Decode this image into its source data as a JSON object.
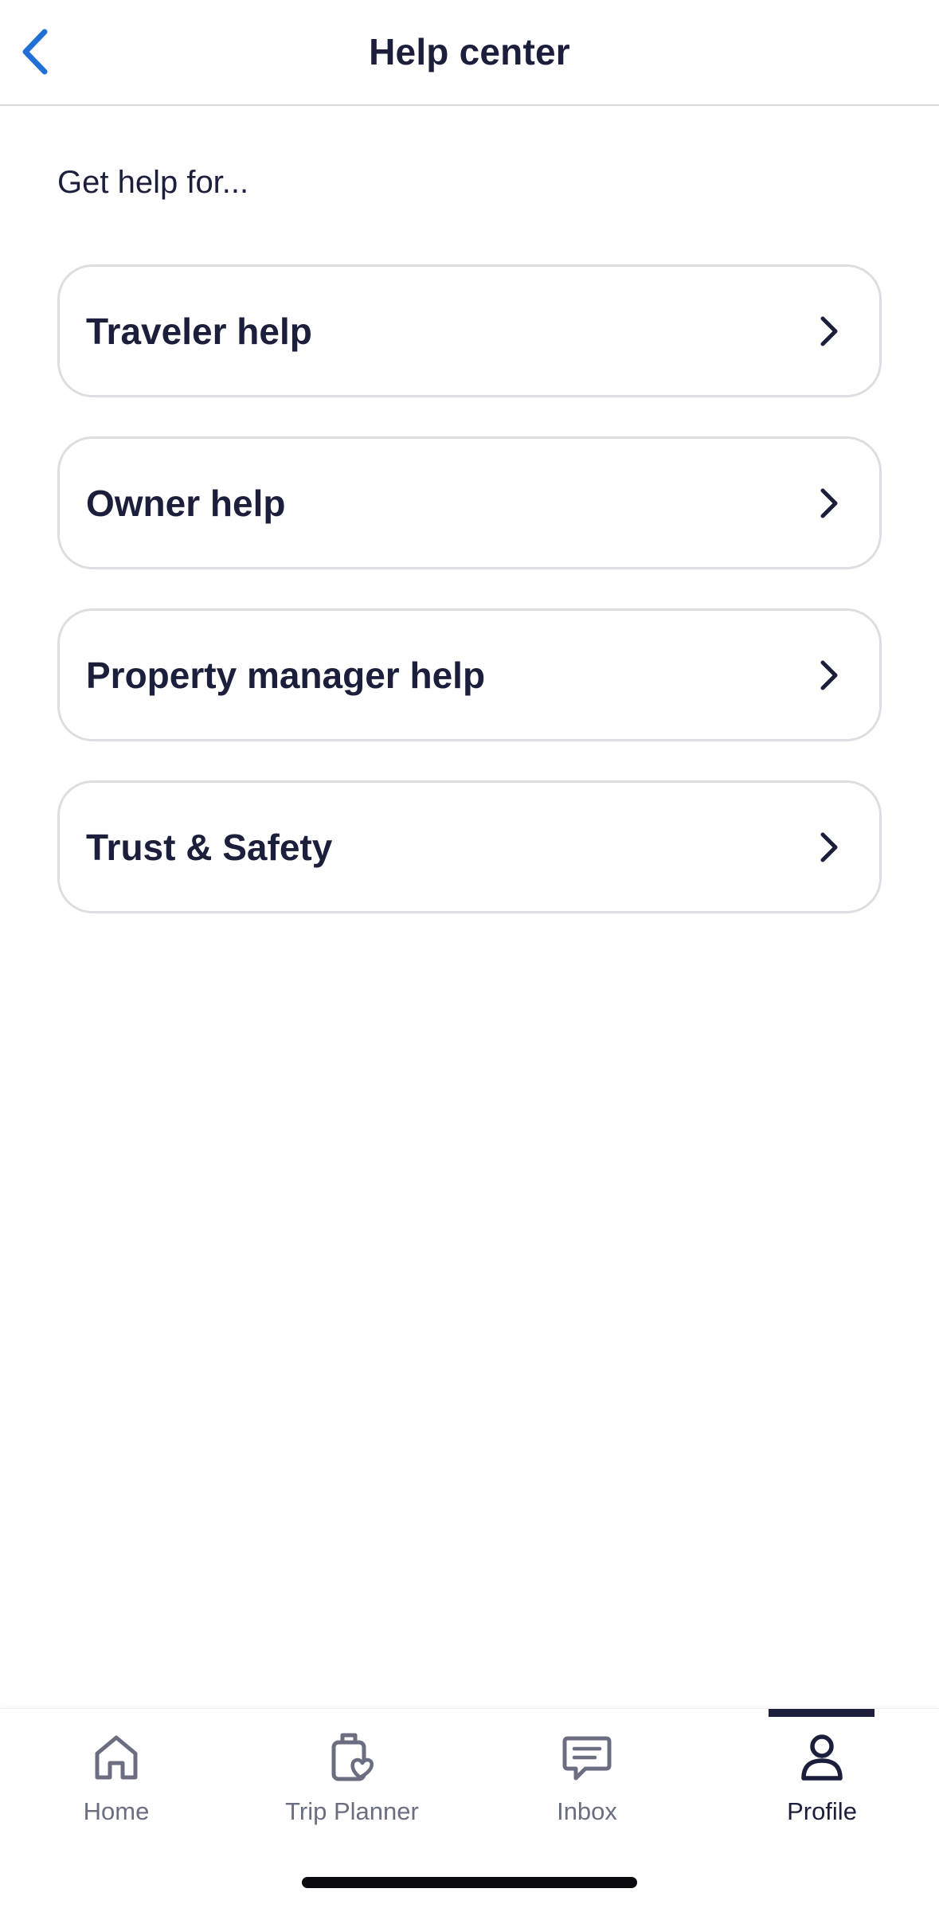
{
  "header": {
    "title": "Help center",
    "back_icon": "chevron-left-icon",
    "accent_color": "#1f6fd6"
  },
  "subheading": "Get help for...",
  "help_options": [
    {
      "label": "Traveler help",
      "icon": "chevron-right-icon"
    },
    {
      "label": "Owner help",
      "icon": "chevron-right-icon"
    },
    {
      "label": "Property manager help",
      "icon": "chevron-right-icon"
    },
    {
      "label": "Trust & Safety",
      "icon": "chevron-right-icon"
    }
  ],
  "tab_bar": {
    "tabs": [
      {
        "label": "Home",
        "icon": "home-icon",
        "active": false
      },
      {
        "label": "Trip Planner",
        "icon": "trip-planner-icon",
        "active": false
      },
      {
        "label": "Inbox",
        "icon": "inbox-icon",
        "active": false
      },
      {
        "label": "Profile",
        "icon": "profile-icon",
        "active": true
      }
    ],
    "active_color": "#1b1f3b",
    "inactive_color": "#6b6e80"
  }
}
